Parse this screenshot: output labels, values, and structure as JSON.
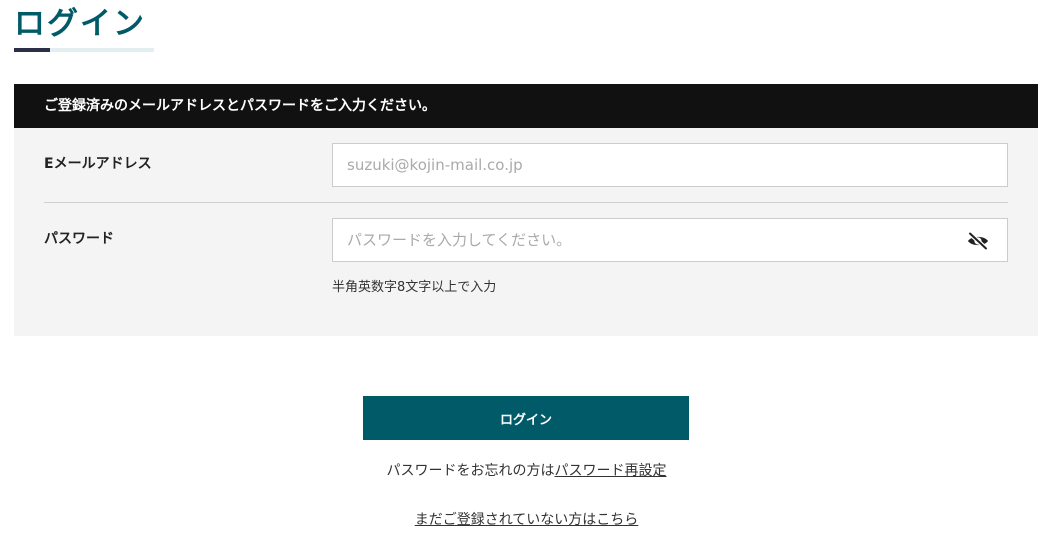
{
  "page": {
    "title": "ログイン"
  },
  "colors": {
    "accent": "#005a68",
    "header_bg": "#111111",
    "panel_bg": "#f4f4f4"
  },
  "form": {
    "header": "ご登録済みのメールアドレスとパスワードをご入力ください。",
    "email": {
      "label": "Eメールアドレス",
      "value": "",
      "placeholder": "suzuki@kojin-mail.co.jp"
    },
    "password": {
      "label": "パスワード",
      "value": "",
      "placeholder": "パスワードを入力してください。",
      "toggle_icon": "eye-off-icon",
      "hint": "半角英数字8文字以上で入力"
    }
  },
  "actions": {
    "login_label": "ログイン",
    "forgot_prefix": "パスワードをお忘れの方は",
    "forgot_link": "パスワード再設定",
    "register_link": "まだご登録されていない方はこちら"
  }
}
